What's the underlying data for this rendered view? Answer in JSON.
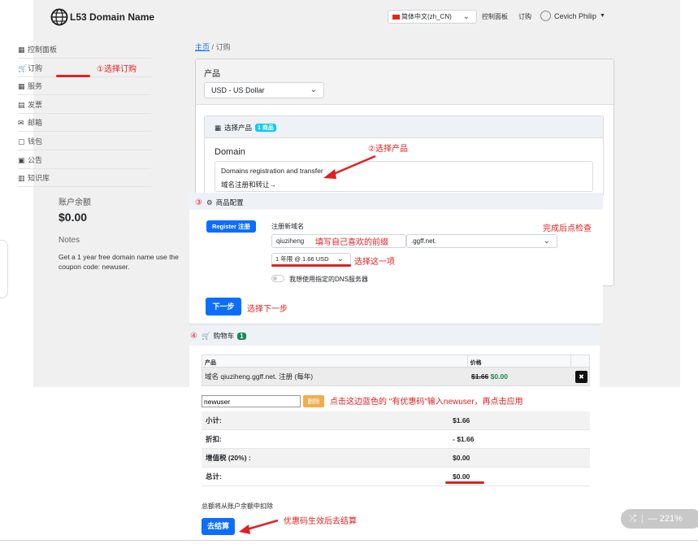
{
  "header": {
    "brand": "L53 Domain Name",
    "language": "简体中文(zh_CN)",
    "dashboard": "控制面板",
    "orders": "订购",
    "user": "Cevich Philip"
  },
  "sidebar": {
    "items": [
      {
        "label": "控制面板",
        "icon": "grid-icon"
      },
      {
        "label": "订购",
        "icon": "cart-icon"
      },
      {
        "label": "服务",
        "icon": "grid-icon"
      },
      {
        "label": "发票",
        "icon": "list-icon"
      },
      {
        "label": "邮箱",
        "icon": "mail-icon"
      },
      {
        "label": "钱包",
        "icon": "wallet-icon"
      },
      {
        "label": "公告",
        "icon": "news-icon"
      },
      {
        "label": "知识库",
        "icon": "book-icon"
      }
    ],
    "balance_title": "账户余额",
    "balance_value": "$0.00",
    "notes_title": "Notes",
    "notes_text": "Get a 1 year free domain name use the coupon code: newuser."
  },
  "breadcrumb": {
    "home": "主页",
    "sep": "/",
    "current": "订购"
  },
  "product_section": {
    "label": "产品",
    "currency": "USD - US Dollar"
  },
  "select_product": {
    "title": "选择产品",
    "badge": "1 商品",
    "product_name": "Domain",
    "product_desc": "Domains registration and transfer",
    "product_link": "域名注册和转让→"
  },
  "config": {
    "title": "商品配置",
    "register_btn": "Register  注册",
    "new_domain_label": "注册新域名",
    "domain_value": "qiuziheng",
    "tld_value": ".ggff.net.",
    "period_value": "1 年限 @ 1.66 USD",
    "dns_label": "我想使用指定的DNS服务器",
    "next_btn": "下一步"
  },
  "cart": {
    "title": "购物车",
    "count": "1",
    "col_product": "产品",
    "col_price": "价格",
    "item_name": "域名 qiuziheng.ggff.net. 注册 (每年)",
    "old_price": "$1.66",
    "new_price": "$0.00",
    "coupon_value": "newuser",
    "delete_btn": "删除",
    "rows": [
      {
        "label": "小计:",
        "value": "$1.66"
      },
      {
        "label": "折扣:",
        "value": "- $1.66"
      },
      {
        "label": "增值税 (20%) :",
        "value": "$0.00"
      },
      {
        "label": "总计:",
        "value": "$0.00"
      }
    ],
    "deduct_note": "总额将从账户余额中扣除",
    "checkout_btn": "去结算"
  },
  "annotations": {
    "a1": "①选择订购",
    "a2": "②选择产品",
    "a3": "③",
    "a4": "④",
    "prefix": "填写自己喜欢的前缀",
    "choose_item": "选择这一项",
    "check_done": "完成后点检查",
    "next_step": "选择下一步",
    "coupon_hint": "点击这边蓝色的 \"有优惠码\"输入newuser，再点击应用",
    "checkout_hint": "优惠码生效后去结算"
  },
  "zoom_widget": {
    "zoom": "221%"
  },
  "colors": {
    "accent": "#0d6efd",
    "annotation": "#e02020",
    "success": "#198754"
  }
}
